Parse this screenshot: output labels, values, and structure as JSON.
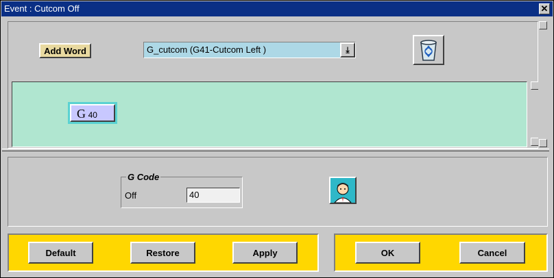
{
  "window": {
    "title": "Event : Cutcom Off",
    "close_label": "✕"
  },
  "toolbar": {
    "add_word_label": "Add Word",
    "combo_value": "G_cutcom (G41-Cutcom Left )",
    "combo_arrow": "⤓"
  },
  "canvas": {
    "word": {
      "letter": "G",
      "value": "40"
    }
  },
  "group": {
    "legend": "G Code",
    "field_label": "Off",
    "field_value": "40"
  },
  "buttons": {
    "default": "Default",
    "restore": "Restore",
    "apply": "Apply",
    "ok": "OK",
    "cancel": "Cancel"
  },
  "colors": {
    "titlebar": "#0a2f85",
    "canvas": "#b0e6d0",
    "button_bar": "#ffd700",
    "combo_bg": "#add8e6"
  }
}
